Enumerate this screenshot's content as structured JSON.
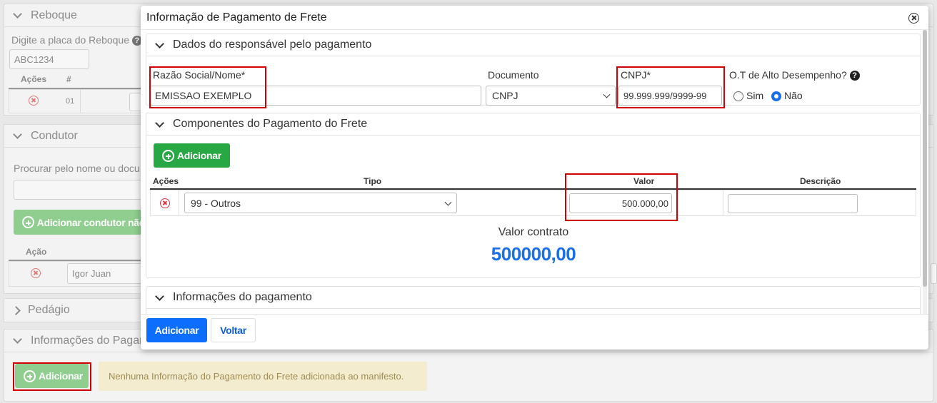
{
  "background": {
    "reboque": {
      "title": "Reboque",
      "plate_label": "Digite a placa do Reboque",
      "plate_value": "ABC1234",
      "col_actions": "Ações",
      "col_number": "#",
      "row_number": "01"
    },
    "condutor": {
      "title": "Condutor",
      "search_label": "Procurar pelo nome ou docu",
      "add_button": "Adicionar condutor não",
      "col_action": "Ação",
      "row_name": "Igor Juan"
    },
    "pedagio": {
      "title": "Pedágio"
    },
    "info_pagamento": {
      "title": "Informações do Pagar",
      "add_button": "Adicionar",
      "empty_message": "Nenhuma Informação do Pagamento do Frete adicionada ao manifesto."
    }
  },
  "modal": {
    "title": "Informação de Pagamento de Frete",
    "responsavel": {
      "title": "Dados do responsável pelo pagamento",
      "razao_label": "Razão Social/Nome*",
      "razao_value": "EMISSAO EXEMPLO",
      "documento_label": "Documento",
      "documento_value": "CNPJ",
      "cnpj_label": "CNPJ*",
      "cnpj_value": "99.999.999/9999-99",
      "alto_desempenho_label": "O.T de Alto Desempenho?",
      "option_sim": "Sim",
      "option_nao": "Não",
      "selected": "Não"
    },
    "componentes": {
      "title": "Componentes do Pagamento do Frete",
      "add_button": "Adicionar",
      "columns": [
        "Ações",
        "Tipo",
        "Valor",
        "Descrição"
      ],
      "row": {
        "tipo": "99 - Outros",
        "valor": "500.000,00",
        "descricao": ""
      },
      "valor_contrato_label": "Valor contrato",
      "valor_contrato": "500000,00"
    },
    "informacoes": {
      "title": "Informações do pagamento"
    },
    "footer": {
      "add_button": "Adicionar",
      "back_button": "Voltar"
    }
  },
  "colors": {
    "primary": "#0d6efd",
    "success": "#28a745",
    "highlight": "#d00000",
    "contract_value": "#1a6ee6"
  }
}
